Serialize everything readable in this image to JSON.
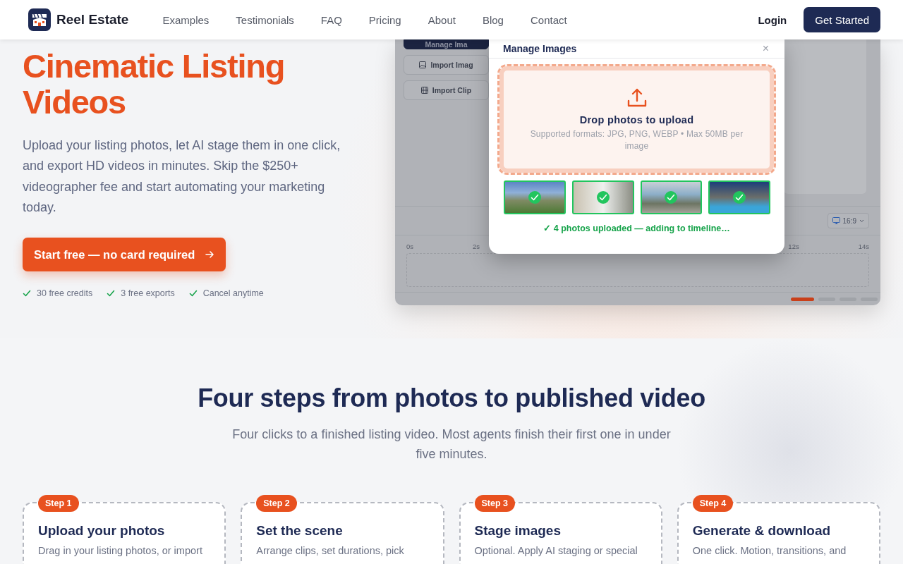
{
  "nav": {
    "brand": "Reel Estate",
    "links": [
      "Examples",
      "Testimonials",
      "FAQ",
      "Pricing",
      "About",
      "Blog",
      "Contact"
    ],
    "login": "Login",
    "cta": "Get Started"
  },
  "hero": {
    "title": "Cinematic Listing Videos",
    "text": "Upload your listing photos, let AI stage them in one click, and export HD videos in minutes. Skip the $250+ videographer fee and start automating your marketing today.",
    "cta": "Start free — no card required",
    "perks": [
      "30 free credits",
      "3 free exports",
      "Cancel anytime"
    ]
  },
  "mockup": {
    "side_buttons": [
      {
        "label": "Manage Ima",
        "selected": true
      },
      {
        "label": "Import Imag",
        "selected": false
      },
      {
        "label": "Import Clip",
        "selected": false
      }
    ],
    "aspect": "16:9",
    "ticks_left": [
      "0s",
      "2s"
    ],
    "ticks_right": [
      "12s",
      "14s"
    ],
    "pager": [
      {
        "selected": true
      },
      {
        "selected": false
      },
      {
        "selected": false
      },
      {
        "selected": false
      }
    ],
    "modal": {
      "title": "Manage Images",
      "close": "×",
      "drop_title": "Drop photos to upload",
      "drop_hint": "Supported formats: JPG, PNG, WEBP • Max 50MB per image",
      "thumbnails": [
        {
          "uploaded": true
        },
        {
          "uploaded": true
        },
        {
          "uploaded": true
        },
        {
          "uploaded": true
        }
      ],
      "status": "✓ 4 photos uploaded — adding to timeline…"
    }
  },
  "steps": {
    "title": "Four steps from photos to published video",
    "subtitle": "Four clicks to a finished listing video. Most agents finish their first one in under five minutes.",
    "items": [
      {
        "badge": "Step 1",
        "title": "Upload your photos",
        "text": "Drag in your listing photos, or import"
      },
      {
        "badge": "Step 2",
        "title": "Set the scene",
        "text": "Arrange clips, set durations, pick"
      },
      {
        "badge": "Step 3",
        "title": "Stage images",
        "text": "Optional. Apply AI staging or special"
      },
      {
        "badge": "Step 4",
        "title": "Generate & download",
        "text": "One click. Motion, transitions, and"
      }
    ]
  }
}
